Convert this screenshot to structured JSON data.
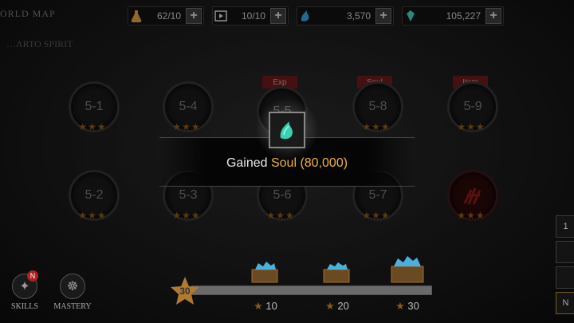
{
  "header": {
    "title": "ORLD MAP",
    "subtitle": "…ARTO SPIRIT",
    "resources": [
      {
        "icon": "stamina-flask-icon",
        "value": "62/10",
        "color": "#e0a040"
      },
      {
        "icon": "ticket-icon",
        "value": "10/10",
        "color": "#dddddd"
      },
      {
        "icon": "soul-crystal-icon",
        "value": "3,570",
        "color": "#40a0e0"
      },
      {
        "icon": "gem-icon",
        "value": "105,227",
        "color": "#40d0c0"
      }
    ],
    "plus_label": "+"
  },
  "stages": [
    {
      "label": "5-1",
      "stars": "★★★"
    },
    {
      "label": "5-4",
      "stars": "★★★"
    },
    {
      "label": "5-5",
      "stars": "★★★",
      "ribbon": "Exp"
    },
    {
      "label": "5-8",
      "stars": "★★★",
      "ribbon": "Soul"
    },
    {
      "label": "5-9",
      "stars": "★★★",
      "ribbon": "Item"
    },
    {
      "label": "5-2",
      "stars": "★★★"
    },
    {
      "label": "5-3",
      "stars": "★★★"
    },
    {
      "label": "5-6",
      "stars": "★★★"
    },
    {
      "label": "5-7",
      "stars": "★★★"
    },
    {
      "label": "",
      "stars": "★★★",
      "boss": true
    }
  ],
  "reward_popup": {
    "prefix": "Gained ",
    "highlight": "Soul (80,000)",
    "icon": "soul-crystal-icon",
    "highlight_color": "#f0b040"
  },
  "side_menu": [
    {
      "label": "SKILLS",
      "badge": "N",
      "icon": "skills-icon"
    },
    {
      "label": "MASTERY",
      "icon": "meditation-icon"
    }
  ],
  "star_progress": {
    "current": "30",
    "fill_fraction": 1.0,
    "milestones": [
      {
        "stars": "10",
        "icon": "treasure-chest-icon"
      },
      {
        "stars": "20",
        "icon": "treasure-chest-icon"
      },
      {
        "stars": "30",
        "icon": "treasure-chest-icon"
      }
    ]
  },
  "right_tabs": [
    "1",
    "",
    "",
    "N"
  ]
}
